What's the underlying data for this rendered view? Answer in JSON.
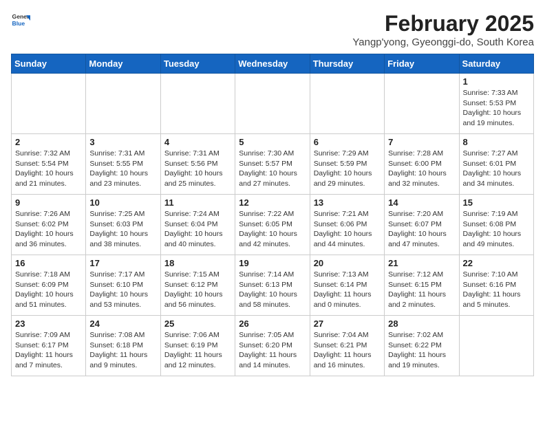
{
  "header": {
    "logo_general": "General",
    "logo_blue": "Blue",
    "title": "February 2025",
    "location": "Yangp'yong, Gyeonggi-do, South Korea"
  },
  "weekdays": [
    "Sunday",
    "Monday",
    "Tuesday",
    "Wednesday",
    "Thursday",
    "Friday",
    "Saturday"
  ],
  "weeks": [
    [
      {
        "day": "",
        "info": ""
      },
      {
        "day": "",
        "info": ""
      },
      {
        "day": "",
        "info": ""
      },
      {
        "day": "",
        "info": ""
      },
      {
        "day": "",
        "info": ""
      },
      {
        "day": "",
        "info": ""
      },
      {
        "day": "1",
        "info": "Sunrise: 7:33 AM\nSunset: 5:53 PM\nDaylight: 10 hours and 19 minutes."
      }
    ],
    [
      {
        "day": "2",
        "info": "Sunrise: 7:32 AM\nSunset: 5:54 PM\nDaylight: 10 hours and 21 minutes."
      },
      {
        "day": "3",
        "info": "Sunrise: 7:31 AM\nSunset: 5:55 PM\nDaylight: 10 hours and 23 minutes."
      },
      {
        "day": "4",
        "info": "Sunrise: 7:31 AM\nSunset: 5:56 PM\nDaylight: 10 hours and 25 minutes."
      },
      {
        "day": "5",
        "info": "Sunrise: 7:30 AM\nSunset: 5:57 PM\nDaylight: 10 hours and 27 minutes."
      },
      {
        "day": "6",
        "info": "Sunrise: 7:29 AM\nSunset: 5:59 PM\nDaylight: 10 hours and 29 minutes."
      },
      {
        "day": "7",
        "info": "Sunrise: 7:28 AM\nSunset: 6:00 PM\nDaylight: 10 hours and 32 minutes."
      },
      {
        "day": "8",
        "info": "Sunrise: 7:27 AM\nSunset: 6:01 PM\nDaylight: 10 hours and 34 minutes."
      }
    ],
    [
      {
        "day": "9",
        "info": "Sunrise: 7:26 AM\nSunset: 6:02 PM\nDaylight: 10 hours and 36 minutes."
      },
      {
        "day": "10",
        "info": "Sunrise: 7:25 AM\nSunset: 6:03 PM\nDaylight: 10 hours and 38 minutes."
      },
      {
        "day": "11",
        "info": "Sunrise: 7:24 AM\nSunset: 6:04 PM\nDaylight: 10 hours and 40 minutes."
      },
      {
        "day": "12",
        "info": "Sunrise: 7:22 AM\nSunset: 6:05 PM\nDaylight: 10 hours and 42 minutes."
      },
      {
        "day": "13",
        "info": "Sunrise: 7:21 AM\nSunset: 6:06 PM\nDaylight: 10 hours and 44 minutes."
      },
      {
        "day": "14",
        "info": "Sunrise: 7:20 AM\nSunset: 6:07 PM\nDaylight: 10 hours and 47 minutes."
      },
      {
        "day": "15",
        "info": "Sunrise: 7:19 AM\nSunset: 6:08 PM\nDaylight: 10 hours and 49 minutes."
      }
    ],
    [
      {
        "day": "16",
        "info": "Sunrise: 7:18 AM\nSunset: 6:09 PM\nDaylight: 10 hours and 51 minutes."
      },
      {
        "day": "17",
        "info": "Sunrise: 7:17 AM\nSunset: 6:10 PM\nDaylight: 10 hours and 53 minutes."
      },
      {
        "day": "18",
        "info": "Sunrise: 7:15 AM\nSunset: 6:12 PM\nDaylight: 10 hours and 56 minutes."
      },
      {
        "day": "19",
        "info": "Sunrise: 7:14 AM\nSunset: 6:13 PM\nDaylight: 10 hours and 58 minutes."
      },
      {
        "day": "20",
        "info": "Sunrise: 7:13 AM\nSunset: 6:14 PM\nDaylight: 11 hours and 0 minutes."
      },
      {
        "day": "21",
        "info": "Sunrise: 7:12 AM\nSunset: 6:15 PM\nDaylight: 11 hours and 2 minutes."
      },
      {
        "day": "22",
        "info": "Sunrise: 7:10 AM\nSunset: 6:16 PM\nDaylight: 11 hours and 5 minutes."
      }
    ],
    [
      {
        "day": "23",
        "info": "Sunrise: 7:09 AM\nSunset: 6:17 PM\nDaylight: 11 hours and 7 minutes."
      },
      {
        "day": "24",
        "info": "Sunrise: 7:08 AM\nSunset: 6:18 PM\nDaylight: 11 hours and 9 minutes."
      },
      {
        "day": "25",
        "info": "Sunrise: 7:06 AM\nSunset: 6:19 PM\nDaylight: 11 hours and 12 minutes."
      },
      {
        "day": "26",
        "info": "Sunrise: 7:05 AM\nSunset: 6:20 PM\nDaylight: 11 hours and 14 minutes."
      },
      {
        "day": "27",
        "info": "Sunrise: 7:04 AM\nSunset: 6:21 PM\nDaylight: 11 hours and 16 minutes."
      },
      {
        "day": "28",
        "info": "Sunrise: 7:02 AM\nSunset: 6:22 PM\nDaylight: 11 hours and 19 minutes."
      },
      {
        "day": "",
        "info": ""
      }
    ]
  ]
}
